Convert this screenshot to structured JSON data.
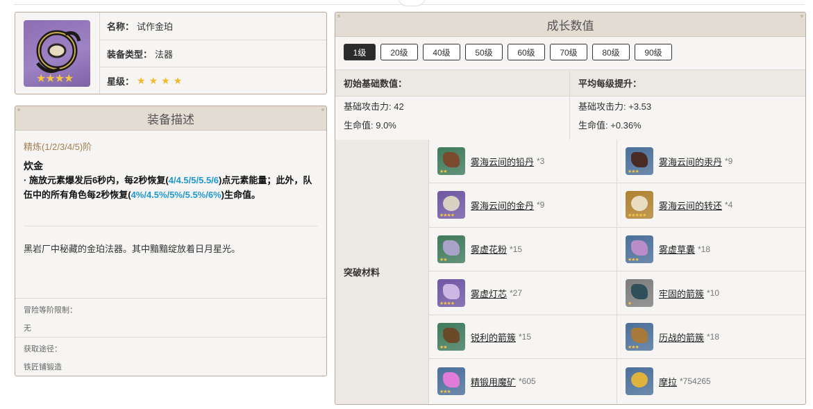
{
  "info": {
    "name_label": "名称：",
    "name_value": "试作金珀",
    "type_label": "装备类型：",
    "type_value": "法器",
    "star_label": "星级：",
    "stars": [
      "★",
      "★",
      "★",
      "★"
    ]
  },
  "desc": {
    "title": "装备描述",
    "refine": "精炼(1/2/3/4/5)阶",
    "skill_name": "炊金",
    "effect": {
      "p1": "· 施放元素爆发后6秒内，每2秒恢复(",
      "hl1": "4/4.5/5/5.5/6",
      "p2": ")点元素能量；此外，队伍中的所有角色每2秒恢复(",
      "hl2": "4%/4.5%/5%/5.5%/6%",
      "p3": ")生命值。"
    },
    "lore": "黑岩厂中秘藏的金珀法器。其中黯黯绽放着日月星光。",
    "ar_label": "冒险等阶限制：",
    "ar_value": "无",
    "source_label": "获取途径：",
    "source_value": "铁匠铺锻造"
  },
  "growth": {
    "title": "成长数值",
    "levels": [
      "1级",
      "20级",
      "40级",
      "50级",
      "60级",
      "70级",
      "80级",
      "90级"
    ],
    "active_level": "1级",
    "base_header": "初始基础数值：",
    "avg_header": "平均每级提升：",
    "base_atk": "基础攻击力: 42",
    "base_hp": "生命值: 9.0%",
    "avg_atk": "基础攻击力: +3.53",
    "avg_hp": "生命值: +0.36%",
    "materials_label": "突破材料",
    "materials": [
      {
        "name": "雾海云间的铅丹",
        "count": "*3",
        "stars": "★★",
        "bg": "#3f7a5c",
        "glyph": "#7a4a2e"
      },
      {
        "name": "雾海云间的汞丹",
        "count": "*9",
        "stars": "★★★",
        "bg": "#4a6f9a",
        "glyph": "#4a2a24"
      },
      {
        "name": "雾海云间的金丹",
        "count": "*9",
        "stars": "★★★★",
        "bg": "#6f57a3",
        "glyph": "#d9d2c4"
      },
      {
        "name": "雾海云间的转还",
        "count": "*4",
        "stars": "★★★★★",
        "bg": "#b0822f",
        "glyph": "#e8ddc0"
      },
      {
        "name": "雾虚花粉",
        "count": "*15",
        "stars": "★★",
        "bg": "#3f7a5c",
        "glyph": "#a9a2c8"
      },
      {
        "name": "雾虚草囊",
        "count": "*18",
        "stars": "★★★",
        "bg": "#4a6f9a",
        "glyph": "#b98ec8"
      },
      {
        "name": "雾虚灯芯",
        "count": "*27",
        "stars": "★★★★",
        "bg": "#6f57a3",
        "glyph": "#cdb7e4"
      },
      {
        "name": "牢固的箭簇",
        "count": "*10",
        "stars": "★",
        "bg": "#7d7d7d",
        "glyph": "#2f4f5a"
      },
      {
        "name": "锐利的箭簇",
        "count": "*15",
        "stars": "★★",
        "bg": "#3f7a5c",
        "glyph": "#6b4a2a"
      },
      {
        "name": "历战的箭簇",
        "count": "*18",
        "stars": "★★★",
        "bg": "#4a6f9a",
        "glyph": "#a87a3a"
      },
      {
        "name": "精锻用魔矿",
        "count": "*605",
        "stars": "★★★",
        "bg": "#4a6f9a",
        "glyph": "#e07bd8"
      },
      {
        "name": "摩拉",
        "count": "*754265",
        "stars": "",
        "bg": "#4a6f9a",
        "glyph": "#e0b43c"
      }
    ]
  }
}
